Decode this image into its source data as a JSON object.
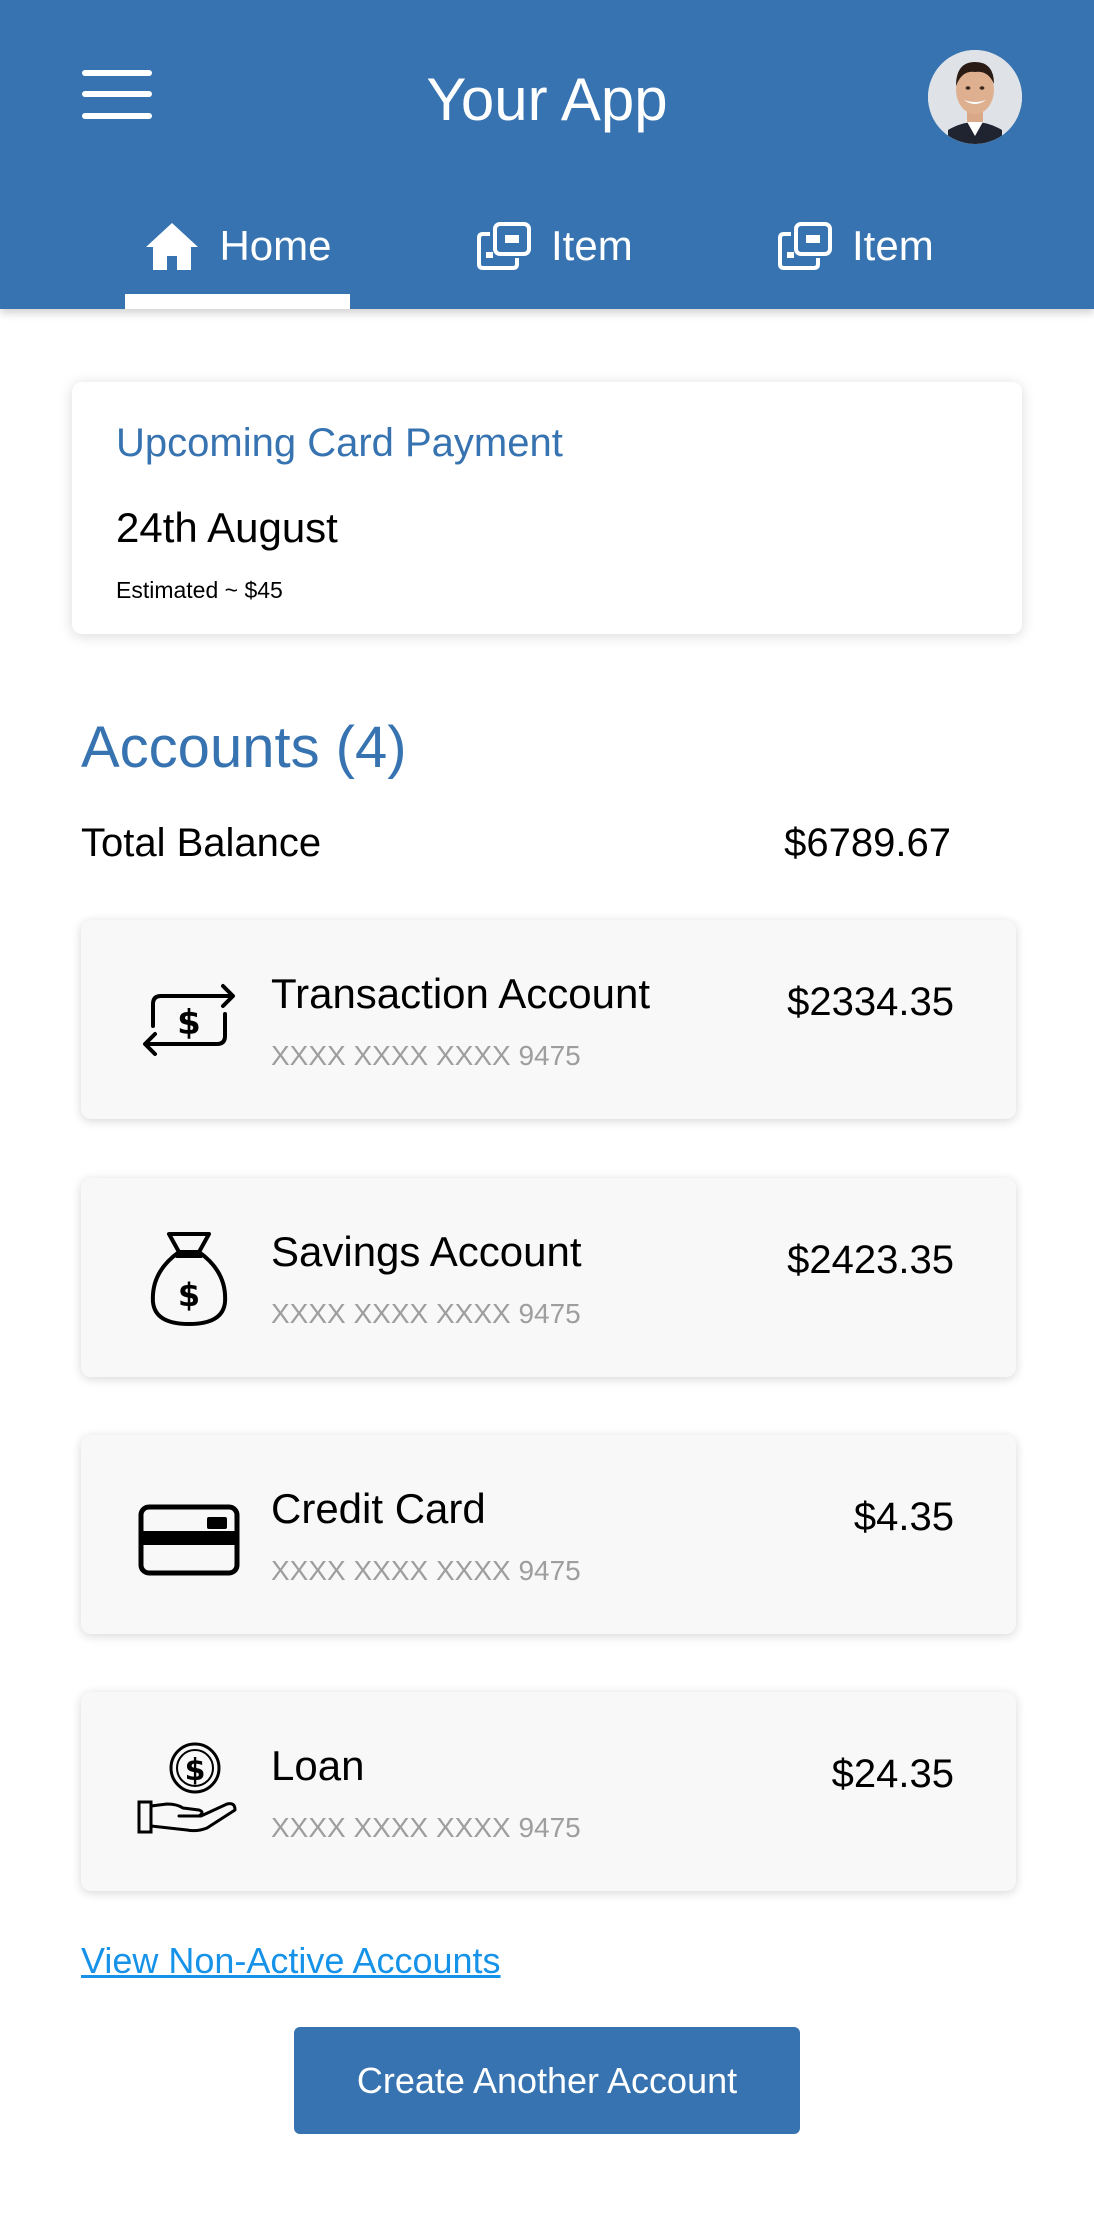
{
  "header": {
    "title": "Your App",
    "menu_icon": "hamburger-menu-icon",
    "avatar_icon": "user-avatar",
    "background_color": "#3673b0"
  },
  "tabs": [
    {
      "label": "Home",
      "icon": "home-icon",
      "active": true
    },
    {
      "label": "Item",
      "icon": "item-icon",
      "active": false
    },
    {
      "label": "Item",
      "icon": "item-icon",
      "active": false
    }
  ],
  "upcoming_payment": {
    "title": "Upcoming Card Payment",
    "date": "24th August",
    "estimate": "Estimated ~ $45"
  },
  "accounts_section": {
    "title": "Accounts (4)",
    "total_label": "Total Balance",
    "total_value": "$6789.67"
  },
  "accounts": [
    {
      "name": "Transaction Account",
      "number": "XXXX XXXX XXXX 9475",
      "balance": "$2334.35",
      "icon": "money-transfer-icon"
    },
    {
      "name": "Savings Account",
      "number": "XXXX XXXX XXXX 9475",
      "balance": "$2423.35",
      "icon": "money-bag-icon"
    },
    {
      "name": "Credit Card",
      "number": "XXXX XXXX XXXX 9475",
      "balance": "$4.35",
      "icon": "credit-card-icon"
    },
    {
      "name": "Loan",
      "number": "XXXX XXXX XXXX 9475",
      "balance": "$24.35",
      "icon": "loan-hand-coin-icon"
    }
  ],
  "links": {
    "non_active": "View Non-Active Accounts"
  },
  "actions": {
    "create_account": "Create Another Account"
  },
  "colors": {
    "primary": "#3673b0",
    "link": "#1693e8",
    "card_bg": "#f8f8f8",
    "muted_text": "#9e9e9e"
  }
}
